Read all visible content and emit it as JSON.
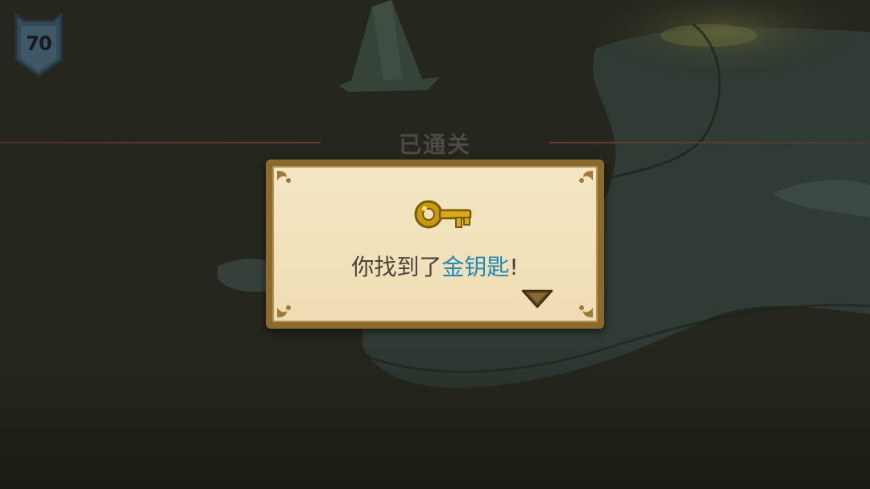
{
  "hud": {
    "level_badge": "70"
  },
  "section": {
    "title": "已通关"
  },
  "dialog": {
    "message_prefix": "你找到了",
    "message_highlight": "金钥匙",
    "message_suffix": "!",
    "icon": "golden-key-icon",
    "advance_icon": "triangle-down-icon"
  },
  "colors": {
    "highlight": "#1d8ab8",
    "dialog_paper": "#f4e6c4",
    "dialog_frame": "#8a6a2e",
    "divider": "#6e3c32"
  }
}
